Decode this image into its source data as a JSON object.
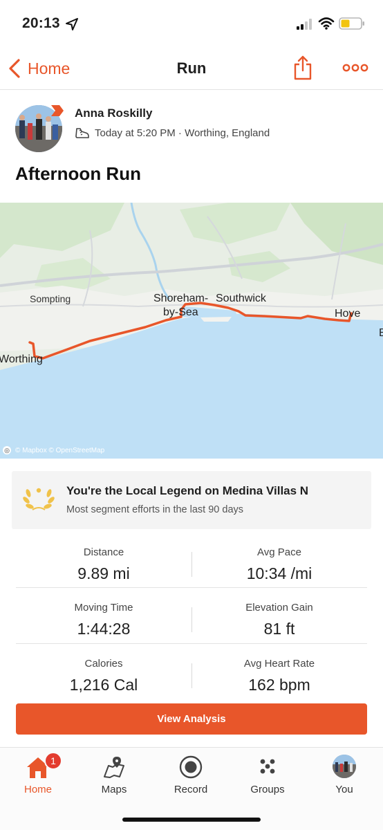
{
  "status_bar": {
    "time": "20:13",
    "icons": [
      "location-arrow-icon",
      "cellular-signal-icon",
      "wifi-icon",
      "battery-icon"
    ]
  },
  "nav": {
    "back_label": "Home",
    "title": "Run",
    "share_icon": "share-icon",
    "more_icon": "more-icon"
  },
  "activity": {
    "athlete_name": "Anna Roskilly",
    "meta": "Today at 5:20 PM · Worthing, England",
    "title": "Afternoon Run"
  },
  "map": {
    "labels": {
      "sompting": "Sompting",
      "shoreham": "Shoreham-",
      "bysea": "by-Sea",
      "southwick": "Southwick",
      "hove": "Hove",
      "worthing": "Worthing",
      "edge_b": "B"
    },
    "attribution": "© Mapbox © OpenStreetMap",
    "route_color": "#e8562a",
    "sea_color": "#bfe0f6",
    "land_color": "#e9efe6"
  },
  "local_legend": {
    "title": "You're the Local Legend on Medina Villas N",
    "subtitle": "Most segment efforts in the last 90 days"
  },
  "stats": [
    {
      "label": "Distance",
      "value": "9.89 mi"
    },
    {
      "label": "Avg Pace",
      "value": "10:34 /mi"
    },
    {
      "label": "Moving Time",
      "value": "1:44:28"
    },
    {
      "label": "Elevation Gain",
      "value": "81 ft"
    },
    {
      "label": "Calories",
      "value": "1,216 Cal"
    },
    {
      "label": "Avg Heart Rate",
      "value": "162 bpm"
    }
  ],
  "view_analysis_label": "View Analysis",
  "tabs": [
    {
      "label": "Home",
      "icon": "home-icon",
      "badge": "1"
    },
    {
      "label": "Maps",
      "icon": "maps-icon"
    },
    {
      "label": "Record",
      "icon": "record-icon"
    },
    {
      "label": "Groups",
      "icon": "groups-icon"
    },
    {
      "label": "You",
      "icon": "profile-avatar"
    }
  ],
  "colors": {
    "accent": "#e8562a",
    "badge": "#e33c2f",
    "legend_gold": "#f0c24a"
  }
}
